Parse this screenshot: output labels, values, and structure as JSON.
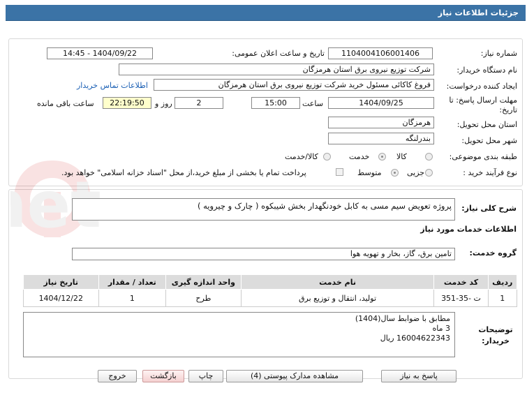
{
  "header": {
    "title": "جزئیات اطلاعات نیاز"
  },
  "form": {
    "need_number": {
      "label": "شماره نیاز:",
      "value": "1104004106001406"
    },
    "announce_datetime": {
      "label": "تاریخ و ساعت اعلان عمومی:",
      "value": "1404/09/22 - 14:45"
    },
    "buyer_org": {
      "label": "نام دستگاه خریدار:",
      "value": "شرکت توزیع نیروی برق استان هرمزگان"
    },
    "requester": {
      "label": "ایجاد کننده درخواست:",
      "value": "فروغ کاکائی مسئول خرید شرکت توزیع نیروی برق استان هرمزگان",
      "contact_link": "اطلاعات تماس خریدار"
    },
    "deadline": {
      "label": "مهلت ارسال پاسخ: تا تاریخ:",
      "date": "1404/09/25",
      "time_label": "ساعت",
      "time": "15:00",
      "days": "2",
      "days_label": "روز و",
      "remaining": "22:19:50",
      "remaining_label": "ساعت باقی مانده"
    },
    "province": {
      "label": "استان محل تحویل:",
      "value": "هرمزگان"
    },
    "city": {
      "label": "شهر محل تحویل:",
      "value": "بندرلنگه"
    },
    "category": {
      "label": "طبقه بندی موضوعی:",
      "options": [
        "کالا",
        "خدمت",
        "کالا/خدمت"
      ],
      "selected": "خدمت"
    },
    "process_type": {
      "label": "نوع فرآیند خرید :",
      "options": [
        "جزیی",
        "متوسط"
      ],
      "selected": "متوسط",
      "treasury_note": "پرداخت تمام یا بخشی از مبلغ خرید،از محل \"اسناد خزانه اسلامی\" خواهد بود."
    }
  },
  "summary": {
    "label": "شرح کلی نیاز:",
    "value": "پروژه  تعویض سیم مسی به کابل خودنگهدار بخش شیبکوه ( چارک و چیرویه )"
  },
  "services": {
    "title": "اطلاعات خدمات مورد نیاز",
    "group_label": "گروه خدمت:",
    "group_value": "تامین برق، گاز، بخار و تهویه هوا",
    "columns": [
      "ردیف",
      "کد خدمت",
      "نام خدمت",
      "واحد اندازه گیری",
      "تعداد / مقدار",
      "تاریخ نیاز"
    ],
    "rows": [
      [
        "1",
        "ت -35-351",
        "تولید، انتقال و توزیع برق",
        "طرح",
        "1",
        "1404/12/22"
      ]
    ]
  },
  "buyer_notes": {
    "label": "توضیحات خریدار:",
    "lines": [
      "مطابق با ضوابط سال(1404)",
      "3 ماه",
      "16004622343 ریال"
    ]
  },
  "buttons": {
    "reply": "پاسخ به نیاز",
    "attachments": "مشاهده مدارک پیوستی (4)",
    "print": "چاپ",
    "back": "بازگشت",
    "exit": "خروج"
  },
  "watermark": "AriaTender.net"
}
